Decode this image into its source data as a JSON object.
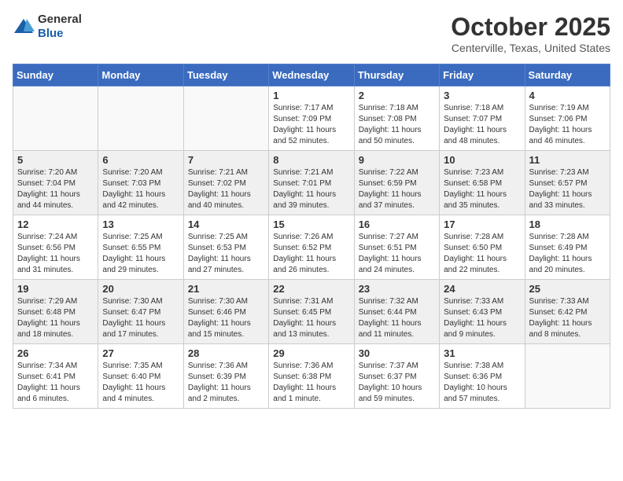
{
  "header": {
    "logo_general": "General",
    "logo_blue": "Blue",
    "month_title": "October 2025",
    "location": "Centerville, Texas, United States"
  },
  "days_of_week": [
    "Sunday",
    "Monday",
    "Tuesday",
    "Wednesday",
    "Thursday",
    "Friday",
    "Saturday"
  ],
  "weeks": [
    [
      {
        "day": "",
        "info": ""
      },
      {
        "day": "",
        "info": ""
      },
      {
        "day": "",
        "info": ""
      },
      {
        "day": "1",
        "info": "Sunrise: 7:17 AM\nSunset: 7:09 PM\nDaylight: 11 hours and 52 minutes."
      },
      {
        "day": "2",
        "info": "Sunrise: 7:18 AM\nSunset: 7:08 PM\nDaylight: 11 hours and 50 minutes."
      },
      {
        "day": "3",
        "info": "Sunrise: 7:18 AM\nSunset: 7:07 PM\nDaylight: 11 hours and 48 minutes."
      },
      {
        "day": "4",
        "info": "Sunrise: 7:19 AM\nSunset: 7:06 PM\nDaylight: 11 hours and 46 minutes."
      }
    ],
    [
      {
        "day": "5",
        "info": "Sunrise: 7:20 AM\nSunset: 7:04 PM\nDaylight: 11 hours and 44 minutes."
      },
      {
        "day": "6",
        "info": "Sunrise: 7:20 AM\nSunset: 7:03 PM\nDaylight: 11 hours and 42 minutes."
      },
      {
        "day": "7",
        "info": "Sunrise: 7:21 AM\nSunset: 7:02 PM\nDaylight: 11 hours and 40 minutes."
      },
      {
        "day": "8",
        "info": "Sunrise: 7:21 AM\nSunset: 7:01 PM\nDaylight: 11 hours and 39 minutes."
      },
      {
        "day": "9",
        "info": "Sunrise: 7:22 AM\nSunset: 6:59 PM\nDaylight: 11 hours and 37 minutes."
      },
      {
        "day": "10",
        "info": "Sunrise: 7:23 AM\nSunset: 6:58 PM\nDaylight: 11 hours and 35 minutes."
      },
      {
        "day": "11",
        "info": "Sunrise: 7:23 AM\nSunset: 6:57 PM\nDaylight: 11 hours and 33 minutes."
      }
    ],
    [
      {
        "day": "12",
        "info": "Sunrise: 7:24 AM\nSunset: 6:56 PM\nDaylight: 11 hours and 31 minutes."
      },
      {
        "day": "13",
        "info": "Sunrise: 7:25 AM\nSunset: 6:55 PM\nDaylight: 11 hours and 29 minutes."
      },
      {
        "day": "14",
        "info": "Sunrise: 7:25 AM\nSunset: 6:53 PM\nDaylight: 11 hours and 27 minutes."
      },
      {
        "day": "15",
        "info": "Sunrise: 7:26 AM\nSunset: 6:52 PM\nDaylight: 11 hours and 26 minutes."
      },
      {
        "day": "16",
        "info": "Sunrise: 7:27 AM\nSunset: 6:51 PM\nDaylight: 11 hours and 24 minutes."
      },
      {
        "day": "17",
        "info": "Sunrise: 7:28 AM\nSunset: 6:50 PM\nDaylight: 11 hours and 22 minutes."
      },
      {
        "day": "18",
        "info": "Sunrise: 7:28 AM\nSunset: 6:49 PM\nDaylight: 11 hours and 20 minutes."
      }
    ],
    [
      {
        "day": "19",
        "info": "Sunrise: 7:29 AM\nSunset: 6:48 PM\nDaylight: 11 hours and 18 minutes."
      },
      {
        "day": "20",
        "info": "Sunrise: 7:30 AM\nSunset: 6:47 PM\nDaylight: 11 hours and 17 minutes."
      },
      {
        "day": "21",
        "info": "Sunrise: 7:30 AM\nSunset: 6:46 PM\nDaylight: 11 hours and 15 minutes."
      },
      {
        "day": "22",
        "info": "Sunrise: 7:31 AM\nSunset: 6:45 PM\nDaylight: 11 hours and 13 minutes."
      },
      {
        "day": "23",
        "info": "Sunrise: 7:32 AM\nSunset: 6:44 PM\nDaylight: 11 hours and 11 minutes."
      },
      {
        "day": "24",
        "info": "Sunrise: 7:33 AM\nSunset: 6:43 PM\nDaylight: 11 hours and 9 minutes."
      },
      {
        "day": "25",
        "info": "Sunrise: 7:33 AM\nSunset: 6:42 PM\nDaylight: 11 hours and 8 minutes."
      }
    ],
    [
      {
        "day": "26",
        "info": "Sunrise: 7:34 AM\nSunset: 6:41 PM\nDaylight: 11 hours and 6 minutes."
      },
      {
        "day": "27",
        "info": "Sunrise: 7:35 AM\nSunset: 6:40 PM\nDaylight: 11 hours and 4 minutes."
      },
      {
        "day": "28",
        "info": "Sunrise: 7:36 AM\nSunset: 6:39 PM\nDaylight: 11 hours and 2 minutes."
      },
      {
        "day": "29",
        "info": "Sunrise: 7:36 AM\nSunset: 6:38 PM\nDaylight: 11 hours and 1 minute."
      },
      {
        "day": "30",
        "info": "Sunrise: 7:37 AM\nSunset: 6:37 PM\nDaylight: 10 hours and 59 minutes."
      },
      {
        "day": "31",
        "info": "Sunrise: 7:38 AM\nSunset: 6:36 PM\nDaylight: 10 hours and 57 minutes."
      },
      {
        "day": "",
        "info": ""
      }
    ]
  ]
}
